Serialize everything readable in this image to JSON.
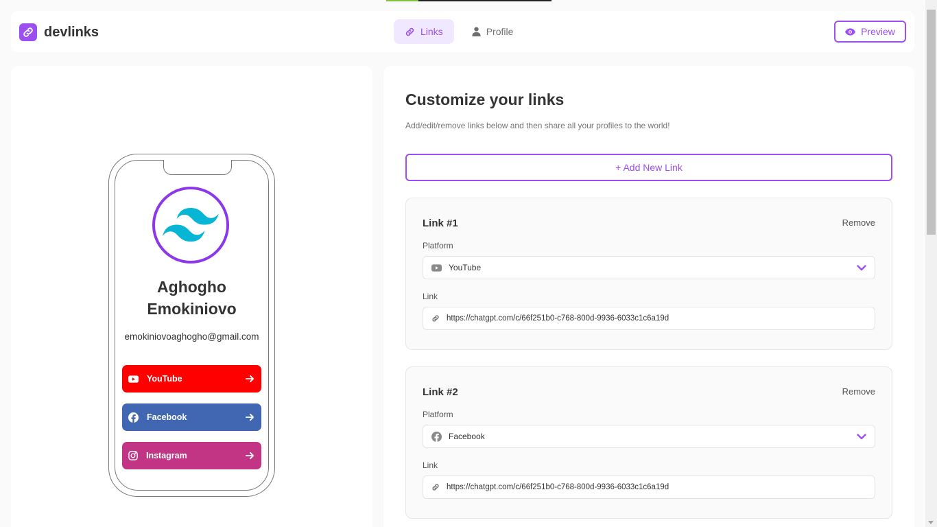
{
  "app": {
    "name": "devlinks"
  },
  "nav": {
    "tabs": [
      {
        "label": "Links",
        "active": true
      },
      {
        "label": "Profile",
        "active": false
      }
    ]
  },
  "header": {
    "preview_label": "Preview"
  },
  "profile": {
    "name_line1": "Aghogho",
    "name_line2": "Emokiniovo",
    "email": "emokiniovoaghogho@gmail.com",
    "links": [
      {
        "platform": "YouTube",
        "color": "#ff0000",
        "icon": "youtube-icon"
      },
      {
        "platform": "Facebook",
        "color": "#4267b2",
        "icon": "facebook-icon"
      },
      {
        "platform": "Instagram",
        "color": "#c13584",
        "icon": "instagram-icon"
      }
    ]
  },
  "editor": {
    "title": "Customize your links",
    "subtitle": "Add/edit/remove links below and then share all your profiles to the world!",
    "add_label": "+ Add New Link",
    "platform_label": "Platform",
    "link_label": "Link",
    "remove_label": "Remove",
    "cards": [
      {
        "title": "Link #1",
        "platform": "YouTube",
        "url": "https://chatgpt.com/c/66f251b0-c768-800d-9936-6033c1c6a19d"
      },
      {
        "title": "Link #2",
        "platform": "Facebook",
        "url": "https://chatgpt.com/c/66f251b0-c768-800d-9936-6033c1c6a19d"
      }
    ]
  },
  "colors": {
    "accent": "#9c4ef0",
    "accent_light": "#efe8ff"
  }
}
